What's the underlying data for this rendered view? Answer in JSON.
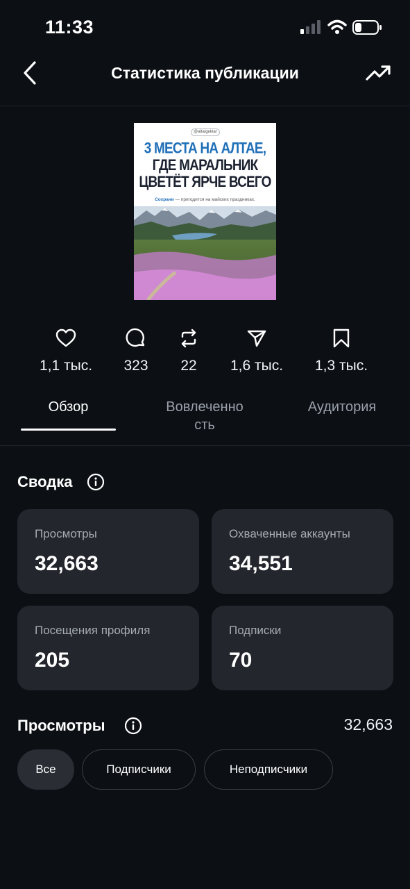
{
  "status_bar": {
    "time": "11:33",
    "signal_bars_active": 1,
    "battery_level": 0.3
  },
  "header": {
    "title": "Статистика публикации",
    "back_icon": "chevron-left-icon",
    "trend_icon": "trending-up-icon"
  },
  "post": {
    "handle": "@altaigektar",
    "headline_line1": "3 МЕСТА НА АЛТАЕ,",
    "headline_line2": "ГДЕ МАРАЛЬНИК",
    "headline_line3": "ЦВЕТЁТ ЯРЧЕ ВСЕГО",
    "subtitle_highlight": "Сохрани",
    "subtitle_rest": " — пригодится на майских праздниках."
  },
  "stats": [
    {
      "icon": "heart-icon",
      "value": "1,1 тыс."
    },
    {
      "icon": "comment-icon",
      "value": "323"
    },
    {
      "icon": "repost-icon",
      "value": "22"
    },
    {
      "icon": "share-icon",
      "value": "1,6 тыс."
    },
    {
      "icon": "bookmark-icon",
      "value": "1,3 тыс."
    }
  ],
  "tabs": [
    {
      "label": "Обзор",
      "active": true
    },
    {
      "label_line1": "Вовлеченно",
      "label_line2": "сть",
      "active": false
    },
    {
      "label": "Аудитория",
      "active": false
    }
  ],
  "summary": {
    "title": "Сводка",
    "cards": [
      {
        "label": "Просмотры",
        "value": "32,663"
      },
      {
        "label": "Охваченные аккаунты",
        "value": "34,551"
      },
      {
        "label": "Посещения профиля",
        "value": "205"
      },
      {
        "label": "Подписки",
        "value": "70"
      }
    ]
  },
  "views_section": {
    "title": "Просмотры",
    "total": "32,663",
    "filters": [
      "Все",
      "Подписчики",
      "Неподписчики"
    ],
    "selected_filter": "Все"
  },
  "colors": {
    "background": "#0c0f14",
    "card": "#23262d",
    "accent_blue": "#1f6fb8"
  }
}
